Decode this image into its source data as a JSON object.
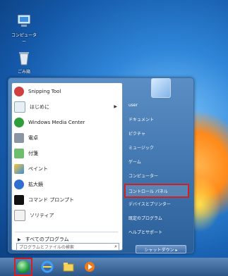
{
  "desktop": {
    "icons": [
      {
        "label": "コンピューター",
        "icon": "computer-icon"
      },
      {
        "label": "ごみ箱",
        "icon": "recycle-bin-icon"
      }
    ]
  },
  "start_menu": {
    "programs": [
      {
        "label": "Snipping Tool",
        "icon": "scissors-icon",
        "has_arrow": false
      },
      {
        "label": "はじめに",
        "icon": "getting-started-icon",
        "has_arrow": true
      },
      {
        "label": "Windows Media Center",
        "icon": "media-center-icon",
        "has_arrow": false
      },
      {
        "label": "電卓",
        "icon": "calculator-icon",
        "has_arrow": false
      },
      {
        "label": "付箋",
        "icon": "sticky-notes-icon",
        "has_arrow": false
      },
      {
        "label": "ペイント",
        "icon": "paint-icon",
        "has_arrow": false
      },
      {
        "label": "拡大鏡",
        "icon": "magnifier-icon",
        "has_arrow": false
      },
      {
        "label": "コマンド プロンプト",
        "icon": "command-prompt-icon",
        "has_arrow": false
      },
      {
        "label": "ソリティア",
        "icon": "solitaire-icon",
        "has_arrow": false
      }
    ],
    "all_programs_label": "すべてのプログラム",
    "search_placeholder": "プログラムとファイルの検索",
    "right_items": [
      {
        "label": "user"
      },
      {
        "label": "ドキュメント"
      },
      {
        "label": "ピクチャ"
      },
      {
        "label": "ミュージック"
      },
      {
        "label": "ゲーム"
      },
      {
        "label": "コンピューター"
      },
      {
        "label": "コントロール パネル",
        "highlighted": true
      },
      {
        "label": "デバイスとプリンター"
      },
      {
        "label": "既定のプログラム"
      },
      {
        "label": "ヘルプとサポート"
      }
    ],
    "shutdown_label": "シャットダウン ▸"
  },
  "taskbar": {
    "items": [
      "ie-icon",
      "explorer-icon",
      "media-player-icon"
    ]
  },
  "colors": {
    "highlight": "#d02020",
    "taskbar": "#3d6a9e"
  }
}
